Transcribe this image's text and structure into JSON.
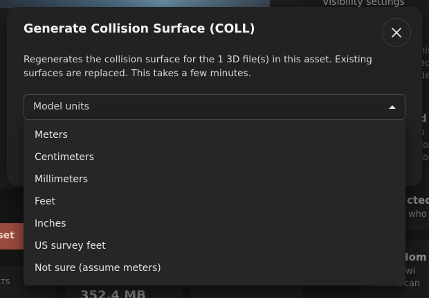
{
  "background": {
    "visibility_settings": "Visibility settings",
    "asset_button_label": "sset",
    "stats_label": "ATS",
    "file_size": "352.4 MB",
    "right_snippets": [
      "nis",
      "ec",
      "de",
      "d",
      "o",
      "to",
      "to"
    ],
    "right_card_title": "cted",
    "right_card_sub": "who",
    "right_card2_title": "c Hom",
    "right_card2_line1": "set wi",
    "right_card2_line2": "who it can"
  },
  "modal": {
    "title": "Generate Collision Surface (COLL)",
    "close_icon": "close-icon",
    "description": "Regenerates the collision surface for the 1 3D file(s) in this asset. Existing surfaces are replaced. This takes a few minutes.",
    "select": {
      "placeholder": "Model units",
      "caret_icon": "caret-up-icon",
      "options": [
        "Meters",
        "Centimeters",
        "Millimeters",
        "Feet",
        "Inches",
        "US survey feet",
        "Not sure (assume meters)"
      ]
    }
  }
}
